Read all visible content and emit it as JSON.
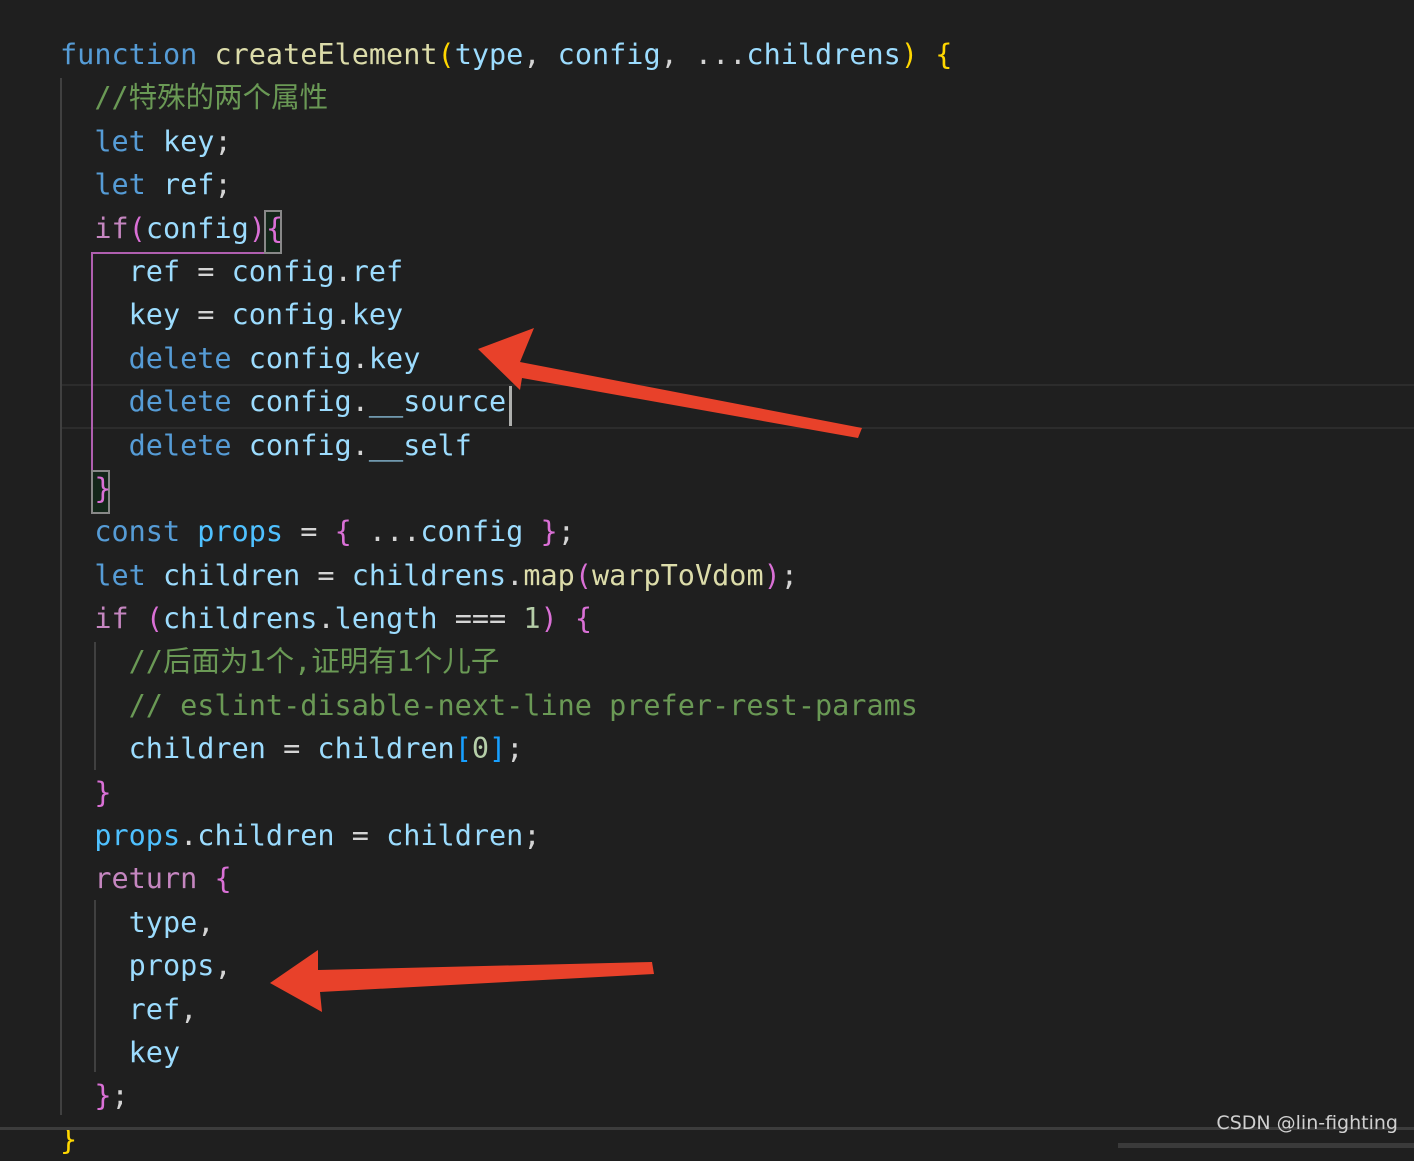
{
  "editor": {
    "lines": [
      [
        [
          "kw",
          "function"
        ],
        [
          "p",
          " "
        ],
        [
          "fn",
          "createElement"
        ],
        [
          "b1",
          "("
        ],
        [
          "var",
          "type"
        ],
        [
          "p",
          ", "
        ],
        [
          "var",
          "config"
        ],
        [
          "p",
          ", ..."
        ],
        [
          "var",
          "childrens"
        ],
        [
          "b1",
          ")"
        ],
        [
          "p",
          " "
        ],
        [
          "b1",
          "{"
        ]
      ],
      [
        [
          "p",
          "  "
        ],
        [
          "com",
          "//特殊的两个属性"
        ]
      ],
      [
        [
          "p",
          "  "
        ],
        [
          "kw",
          "let"
        ],
        [
          "p",
          " "
        ],
        [
          "var",
          "key"
        ],
        [
          "p",
          ";"
        ]
      ],
      [
        [
          "p",
          "  "
        ],
        [
          "kw",
          "let"
        ],
        [
          "p",
          " "
        ],
        [
          "var",
          "ref"
        ],
        [
          "p",
          ";"
        ]
      ],
      [
        [
          "p",
          "  "
        ],
        [
          "ctrl",
          "if"
        ],
        [
          "b2",
          "("
        ],
        [
          "var",
          "config"
        ],
        [
          "b2",
          ")"
        ],
        [
          "b2",
          "{"
        ]
      ],
      [
        [
          "p",
          "    "
        ],
        [
          "var",
          "ref"
        ],
        [
          "p",
          " = "
        ],
        [
          "var",
          "config"
        ],
        [
          "p",
          "."
        ],
        [
          "var",
          "ref"
        ]
      ],
      [
        [
          "p",
          "    "
        ],
        [
          "var",
          "key"
        ],
        [
          "p",
          " = "
        ],
        [
          "var",
          "config"
        ],
        [
          "p",
          "."
        ],
        [
          "var",
          "key"
        ]
      ],
      [
        [
          "p",
          "    "
        ],
        [
          "kw",
          "delete"
        ],
        [
          "p",
          " "
        ],
        [
          "var",
          "config"
        ],
        [
          "p",
          "."
        ],
        [
          "var",
          "key"
        ]
      ],
      [
        [
          "p",
          "    "
        ],
        [
          "kw",
          "delete"
        ],
        [
          "p",
          " "
        ],
        [
          "var",
          "config"
        ],
        [
          "p",
          "."
        ],
        [
          "var",
          "__source"
        ]
      ],
      [
        [
          "p",
          "    "
        ],
        [
          "kw",
          "delete"
        ],
        [
          "p",
          " "
        ],
        [
          "var",
          "config"
        ],
        [
          "p",
          "."
        ],
        [
          "var",
          "__self"
        ]
      ],
      [
        [
          "p",
          "  "
        ],
        [
          "b2",
          "}"
        ]
      ],
      [
        [
          "p",
          "  "
        ],
        [
          "kw",
          "const"
        ],
        [
          "p",
          " "
        ],
        [
          "cst",
          "props"
        ],
        [
          "p",
          " = "
        ],
        [
          "b2",
          "{"
        ],
        [
          "p",
          " ..."
        ],
        [
          "var",
          "config"
        ],
        [
          "p",
          " "
        ],
        [
          "b2",
          "}"
        ],
        [
          "p",
          ";"
        ]
      ],
      [
        [
          "p",
          "  "
        ],
        [
          "kw",
          "let"
        ],
        [
          "p",
          " "
        ],
        [
          "var",
          "children"
        ],
        [
          "p",
          " = "
        ],
        [
          "var",
          "childrens"
        ],
        [
          "p",
          "."
        ],
        [
          "fn",
          "map"
        ],
        [
          "b2",
          "("
        ],
        [
          "fn",
          "warpToVdom"
        ],
        [
          "b2",
          ")"
        ],
        [
          "p",
          ";"
        ]
      ],
      [
        [
          "p",
          "  "
        ],
        [
          "ctrl",
          "if"
        ],
        [
          "p",
          " "
        ],
        [
          "b2",
          "("
        ],
        [
          "var",
          "childrens"
        ],
        [
          "p",
          "."
        ],
        [
          "var",
          "length"
        ],
        [
          "p",
          " === "
        ],
        [
          "num",
          "1"
        ],
        [
          "b2",
          ")"
        ],
        [
          "p",
          " "
        ],
        [
          "b2",
          "{"
        ]
      ],
      [
        [
          "p",
          "    "
        ],
        [
          "com",
          "//后面为1个,证明有1个儿子"
        ]
      ],
      [
        [
          "p",
          "    "
        ],
        [
          "com",
          "// eslint-disable-next-line prefer-rest-params"
        ]
      ],
      [
        [
          "p",
          "    "
        ],
        [
          "var",
          "children"
        ],
        [
          "p",
          " = "
        ],
        [
          "var",
          "children"
        ],
        [
          "b3",
          "["
        ],
        [
          "num",
          "0"
        ],
        [
          "b3",
          "]"
        ],
        [
          "p",
          ";"
        ]
      ],
      [
        [
          "p",
          "  "
        ],
        [
          "b2",
          "}"
        ]
      ],
      [
        [
          "p",
          "  "
        ],
        [
          "cst",
          "props"
        ],
        [
          "p",
          "."
        ],
        [
          "var",
          "children"
        ],
        [
          "p",
          " = "
        ],
        [
          "var",
          "children"
        ],
        [
          "p",
          ";"
        ]
      ],
      [
        [
          "p",
          "  "
        ],
        [
          "ctrl",
          "return"
        ],
        [
          "p",
          " "
        ],
        [
          "b2",
          "{"
        ]
      ],
      [
        [
          "p",
          "    "
        ],
        [
          "var",
          "type"
        ],
        [
          "p",
          ","
        ]
      ],
      [
        [
          "p",
          "    "
        ],
        [
          "var",
          "props"
        ],
        [
          "p",
          ","
        ]
      ],
      [
        [
          "p",
          "    "
        ],
        [
          "var",
          "ref"
        ],
        [
          "p",
          ","
        ]
      ],
      [
        [
          "p",
          "    "
        ],
        [
          "var",
          "key"
        ]
      ],
      [
        [
          "p",
          "  "
        ],
        [
          "b2",
          "}"
        ],
        [
          "p",
          ";"
        ]
      ],
      [
        [
          "b1",
          "}"
        ]
      ]
    ]
  },
  "annotations": {
    "arrow_color": "#e8412a",
    "arrow_count": 2
  },
  "watermark": "CSDN @lin-fighting"
}
